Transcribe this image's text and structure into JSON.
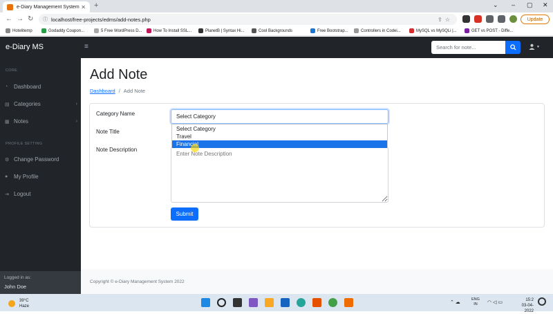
{
  "browser": {
    "tab_title": "e-Diary Management System",
    "new_tab": "+",
    "url": "localhost/free-projects/edms/add-notes.php",
    "update_label": "Update",
    "window_controls": [
      "⌄",
      "–",
      "▢",
      "✕"
    ],
    "bookmarks": [
      "Hotelitemp",
      "Godaddy Coupon...",
      "5 Free WordPress D...",
      "How To Install SSL...",
      "PlanetB | Syntax Hi...",
      "Cool Backgrounds",
      "Free Bootstrap...",
      "Controllers in Codei...",
      "MySQL vs MySQLi |...",
      "GET vs POST - Diffe..."
    ]
  },
  "navbar": {
    "brand": "e-Diary MS",
    "search_placeholder": "Search for note..."
  },
  "sidebar": {
    "core_heading": "CORE",
    "items": [
      {
        "label": "Dashboard",
        "icon": "speedometer-icon"
      },
      {
        "label": "Categories",
        "icon": "columns-icon"
      },
      {
        "label": "Notes",
        "icon": "book-icon"
      }
    ],
    "profile_heading": "PROFILE SETTING",
    "profile_items": [
      {
        "label": "Change Password",
        "icon": "gear-icon"
      },
      {
        "label": "My Profile",
        "icon": "user-icon"
      },
      {
        "label": "Logout",
        "icon": "logout-icon"
      }
    ],
    "logged_in_label": "Logged in as:",
    "user_name": "John Doe"
  },
  "page": {
    "title": "Add Note",
    "breadcrumb_link": "Dashboard",
    "breadcrumb_sep": "/",
    "breadcrumb_current": "Add Note"
  },
  "form": {
    "category_label": "Category Name",
    "category_value": "Select Category",
    "category_options": [
      "Select Category",
      "Travel",
      "Financial"
    ],
    "highlighted_option": "Financial",
    "note_title_label": "Note Title",
    "description_label": "Note Description",
    "description_placeholder": "Enter Note Description",
    "submit_label": "Submit"
  },
  "footer": {
    "copyright": "Copyright © e-Diary Management System 2022"
  },
  "taskbar": {
    "temperature": "39°C",
    "weather": "Haze",
    "lang_1": "ENG",
    "lang_2": "IN",
    "time": "15:2",
    "date": "03-04-2022"
  },
  "colors": {
    "sidebar_bg": "#212529",
    "primary": "#0d6efd",
    "highlight": "#1a73e8"
  }
}
